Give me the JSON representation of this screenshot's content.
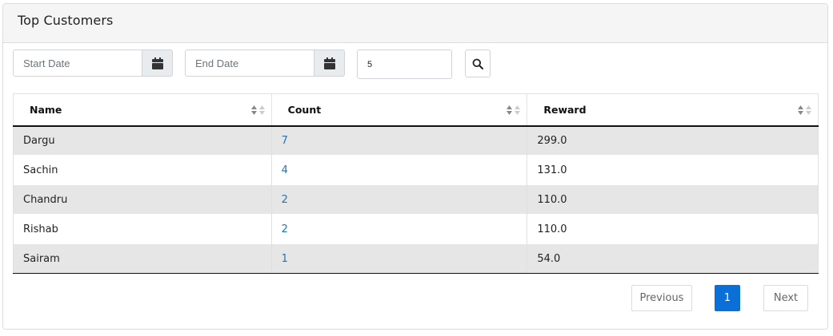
{
  "card": {
    "title": "Top Customers"
  },
  "filters": {
    "start_date_placeholder": "Start Date",
    "end_date_placeholder": "End Date",
    "limit_value": "5"
  },
  "table": {
    "columns": [
      "Name",
      "Count",
      "Reward"
    ],
    "rows": [
      {
        "name": "Dargu",
        "count": "7",
        "reward": "299.0"
      },
      {
        "name": "Sachin",
        "count": "4",
        "reward": "131.0"
      },
      {
        "name": "Chandru",
        "count": "2",
        "reward": "110.0"
      },
      {
        "name": "Rishab",
        "count": "2",
        "reward": "110.0"
      },
      {
        "name": "Sairam",
        "count": "1",
        "reward": "54.0"
      }
    ]
  },
  "pagination": {
    "previous": "Previous",
    "current": "1",
    "next": "Next"
  },
  "colors": {
    "link": "#1e73be",
    "active_page": "#0b6fd8",
    "stripe": "#e6e6e6"
  },
  "icons": {
    "calendar": "calendar-icon",
    "search": "search-icon",
    "sort": "sort-icon"
  }
}
